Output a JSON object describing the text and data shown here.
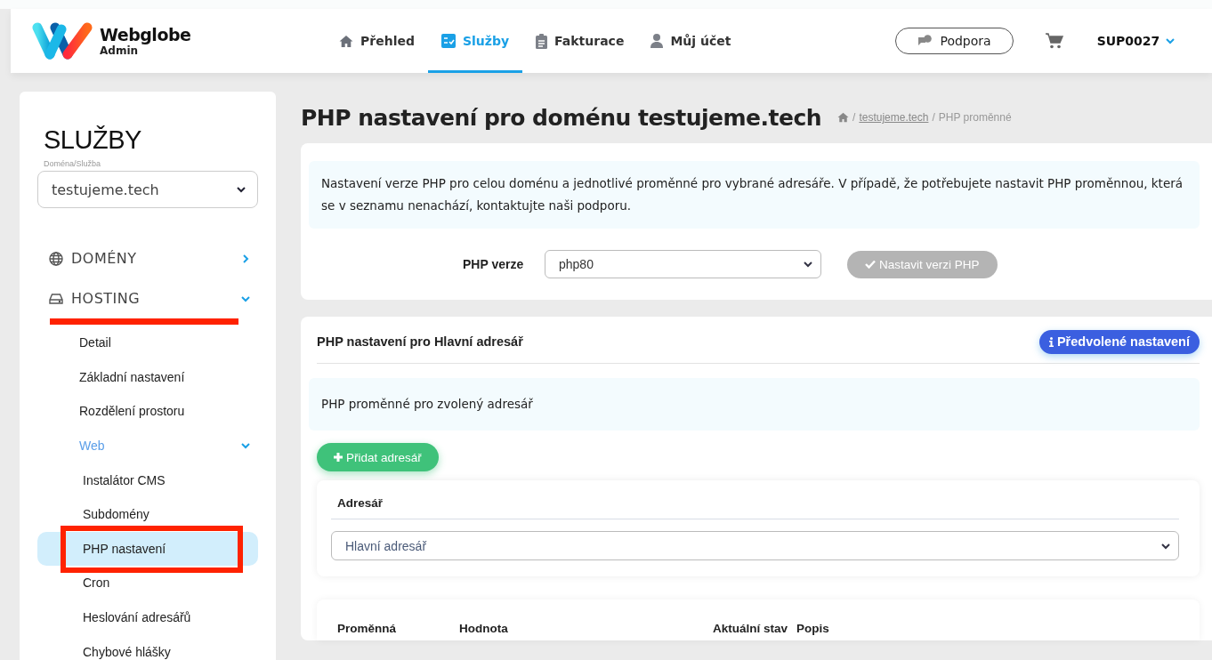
{
  "header": {
    "logo": {
      "name": "Webglobe",
      "subtitle": "Admin"
    },
    "nav": [
      {
        "label": "Přehled",
        "selected": false
      },
      {
        "label": "Služby",
        "selected": true
      },
      {
        "label": "Fakturace",
        "selected": false
      },
      {
        "label": "Můj účet",
        "selected": false
      }
    ],
    "support_button": "Podpora",
    "account": "SUP0027"
  },
  "sidebar": {
    "title": "SLUŽBY",
    "domain_select": {
      "label": "Doména/Služba",
      "value": "testujeme.tech"
    },
    "sections": [
      {
        "label": "DOMÉNY",
        "expanded": false,
        "highlighted": false
      },
      {
        "label": "HOSTING",
        "expanded": true,
        "highlighted": true,
        "children": [
          {
            "label": "Detail",
            "selected": false
          },
          {
            "label": "Základní nastavení",
            "selected": false
          },
          {
            "label": "Rozdělení prostoru",
            "selected": false
          },
          {
            "label": "Web",
            "selected": false,
            "expanded": true,
            "children": [
              {
                "label": "Instalátor CMS",
                "selected": false
              },
              {
                "label": "Subdomény",
                "selected": false
              },
              {
                "label": "PHP nastavení",
                "selected": true,
                "highlighted": true
              },
              {
                "label": "Cron",
                "selected": false
              },
              {
                "label": "Heslování adresářů",
                "selected": false
              },
              {
                "label": "Chybové hlášky",
                "selected": false
              }
            ]
          }
        ]
      }
    ]
  },
  "main": {
    "title": "PHP nastavení pro doménu testujeme.tech",
    "breadcrumb": {
      "separator": "/",
      "items": [
        {
          "kind": "home"
        },
        {
          "kind": "link",
          "label": "testujeme.tech"
        },
        {
          "kind": "current",
          "label": "PHP proměnné"
        }
      ]
    },
    "version_card": {
      "info": "Nastavení verze PHP pro celou doménu a jednotlivé proměnné pro vybrané adresáře. V případě, že potřebujete nastavit PHP proměnnou, která se v seznamu nenachází, kontaktujte naši podporu.",
      "field_label": "PHP verze",
      "field_value": "php80",
      "button": {
        "label": "Nastavit verzi PHP",
        "disabled": true
      }
    },
    "directory_card": {
      "title": "PHP nastavení pro Hlavní adresář",
      "default_button": "Předvolené nastavení",
      "info": "PHP proměnné pro zvolený adresář",
      "add_button": "Přidat adresář",
      "directory": {
        "label": "Adresář",
        "value": "Hlavní adresář"
      },
      "table": {
        "columns": [
          "Proměnná",
          "Hodnota",
          "Aktuální stav",
          "Popis"
        ]
      }
    }
  }
}
